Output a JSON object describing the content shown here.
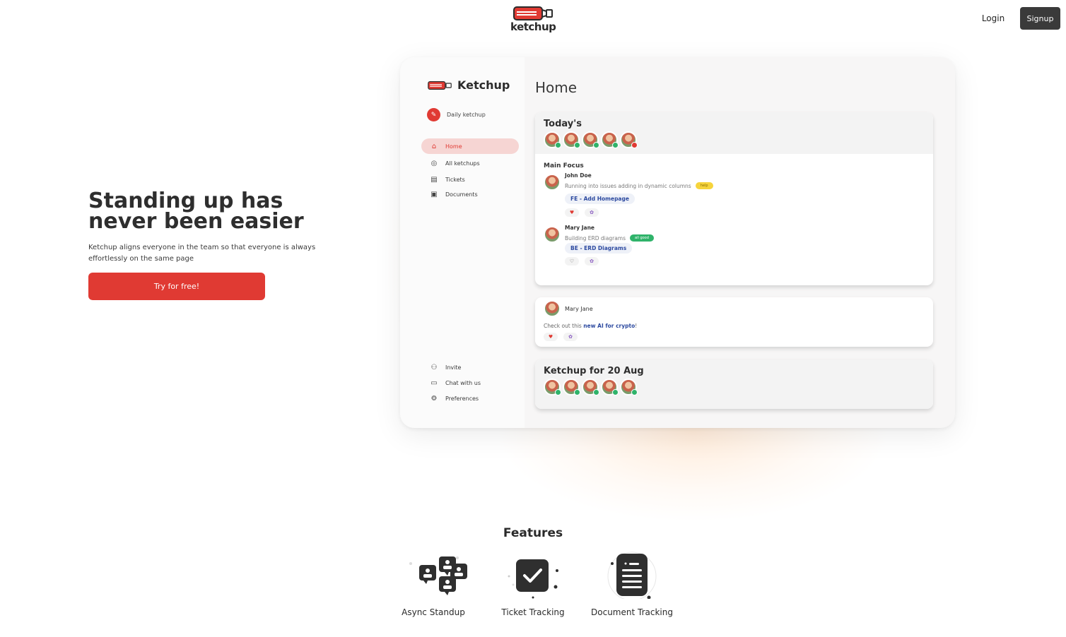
{
  "header": {
    "brand": "ketchup",
    "login_label": "Login",
    "signup_label": "Signup"
  },
  "hero": {
    "title": "Standing up has never been easier",
    "subtitle": "Ketchup aligns everyone in the team so that everyone is always effortlessly on the same page",
    "cta_label": "Try for free!"
  },
  "mock": {
    "brand": "Ketchup",
    "daily_label": "Daily ketchup",
    "nav": [
      {
        "label": "Home",
        "icon": "home-icon"
      },
      {
        "label": "All ketchups",
        "icon": "check-circle-icon"
      },
      {
        "label": "Tickets",
        "icon": "ticket-icon"
      },
      {
        "label": "Documents",
        "icon": "folder-icon"
      }
    ],
    "bottom_nav": [
      {
        "label": "Invite",
        "icon": "user-plus-icon"
      },
      {
        "label": "Chat with us",
        "icon": "chat-icon"
      },
      {
        "label": "Preferences",
        "icon": "gear-icon"
      }
    ],
    "page_title": "Home",
    "today_title": "Today's",
    "main_focus_label": "Main Focus",
    "entries": [
      {
        "name": "John Doe",
        "desc": "Running into issues adding in dynamic columns",
        "badge": "help",
        "ticket": "FE - Add Homepage"
      },
      {
        "name": "Mary Jane",
        "desc": "Building ERD diagrams",
        "badge": "all good",
        "ticket": "BE - ERD Diagrams"
      }
    ],
    "post": {
      "name": "Mary Jane",
      "text_prefix": "Check out this ",
      "text_link": "new AI for crypto",
      "text_suffix": "!"
    },
    "history_title": "Ketchup for 20 Aug"
  },
  "features": {
    "title": "Features",
    "items": [
      {
        "label": "Async Standup",
        "icon": "team-chat-icon"
      },
      {
        "label": "Ticket Tracking",
        "icon": "checkbox-icon"
      },
      {
        "label": "Document Tracking",
        "icon": "document-list-icon"
      }
    ]
  },
  "colors": {
    "brand_red": "#e03a33",
    "dark_button": "#3a3a3a",
    "status_green": "#2fb36a",
    "badge_yellow": "#f6d43c",
    "link_blue": "#2d4aa0"
  }
}
